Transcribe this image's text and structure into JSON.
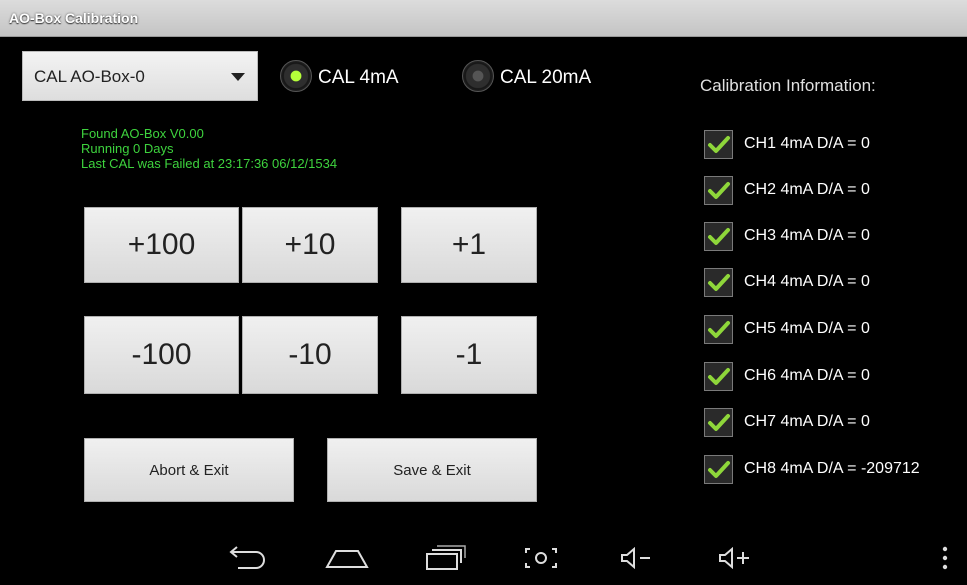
{
  "window": {
    "title": "AO-Box Calibration"
  },
  "device_select": {
    "value": "CAL AO-Box-0"
  },
  "mode": {
    "options": [
      {
        "label": "CAL 4mA",
        "selected": true
      },
      {
        "label": "CAL 20mA",
        "selected": false
      }
    ]
  },
  "status": {
    "line1": "Found AO-Box V0.00",
    "line2": "Running 0 Days",
    "line3": "Last CAL was Failed at 23:17:36 06/12/1534",
    "color": "#3ed33e"
  },
  "adjust": {
    "row1": [
      "+100",
      "+10",
      "+1"
    ],
    "row2": [
      "-100",
      "-10",
      "-1"
    ]
  },
  "actions": {
    "abort": "Abort & Exit",
    "save": "Save & Exit"
  },
  "calibration": {
    "heading": "Calibration Information:",
    "channels": [
      {
        "label": "CH1 4mA D/A = 0",
        "checked": true
      },
      {
        "label": "CH2 4mA D/A = 0",
        "checked": true
      },
      {
        "label": "CH3 4mA D/A = 0",
        "checked": true
      },
      {
        "label": "CH4 4mA D/A = 0",
        "checked": true
      },
      {
        "label": "CH5 4mA D/A = 0",
        "checked": true
      },
      {
        "label": "CH6 4mA D/A = 0",
        "checked": true
      },
      {
        "label": "CH7 4mA D/A = 0",
        "checked": true
      },
      {
        "label": "CH8 4mA D/A = -209712",
        "checked": true
      }
    ],
    "check_color": "#8ed63a"
  },
  "navbar": {
    "icons": [
      "back-icon",
      "home-icon",
      "recent-apps-icon",
      "screenshot-icon",
      "volume-down-icon",
      "volume-up-icon",
      "overflow-menu-icon"
    ]
  }
}
